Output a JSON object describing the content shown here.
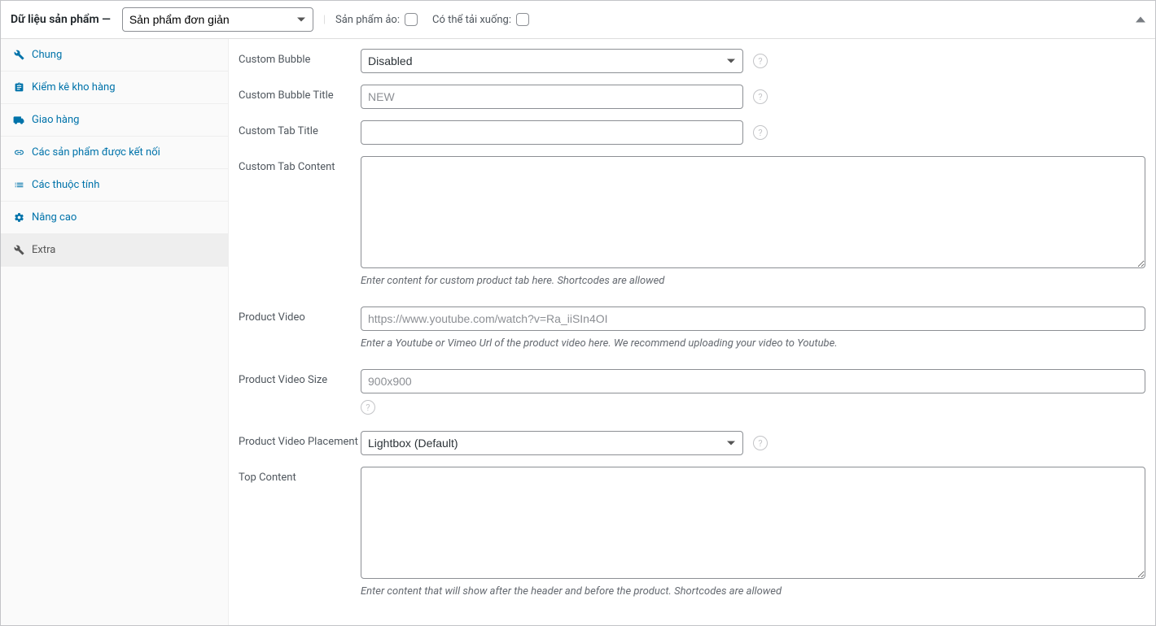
{
  "header": {
    "title": "Dữ liệu sản phẩm —",
    "product_type_selected": "Sản phẩm đơn giản",
    "virtual_label": "Sản phẩm ảo:",
    "downloadable_label": "Có thể tải xuống:"
  },
  "tabs": [
    {
      "label": "Chung"
    },
    {
      "label": "Kiểm kê kho hàng"
    },
    {
      "label": "Giao hàng"
    },
    {
      "label": "Các sản phẩm được kết nối"
    },
    {
      "label": "Các thuộc tính"
    },
    {
      "label": "Nâng cao"
    },
    {
      "label": "Extra"
    }
  ],
  "fields": {
    "custom_bubble": {
      "label": "Custom Bubble",
      "selected": "Disabled"
    },
    "custom_bubble_title": {
      "label": "Custom Bubble Title",
      "placeholder": "NEW",
      "value": ""
    },
    "custom_tab_title": {
      "label": "Custom Tab Title",
      "value": ""
    },
    "custom_tab_content": {
      "label": "Custom Tab Content",
      "value": "",
      "description": "Enter content for custom product tab here. Shortcodes are allowed"
    },
    "product_video": {
      "label": "Product Video",
      "placeholder": "https://www.youtube.com/watch?v=Ra_iiSIn4OI",
      "value": "",
      "description": "Enter a Youtube or Vimeo Url of the product video here. We recommend uploading your video to Youtube."
    },
    "product_video_size": {
      "label": "Product Video Size",
      "placeholder": "900x900",
      "value": ""
    },
    "product_video_placement": {
      "label": "Product Video Placement",
      "selected": "Lightbox (Default)"
    },
    "top_content": {
      "label": "Top Content",
      "value": "",
      "description": "Enter content that will show after the header and before the product. Shortcodes are allowed"
    }
  }
}
